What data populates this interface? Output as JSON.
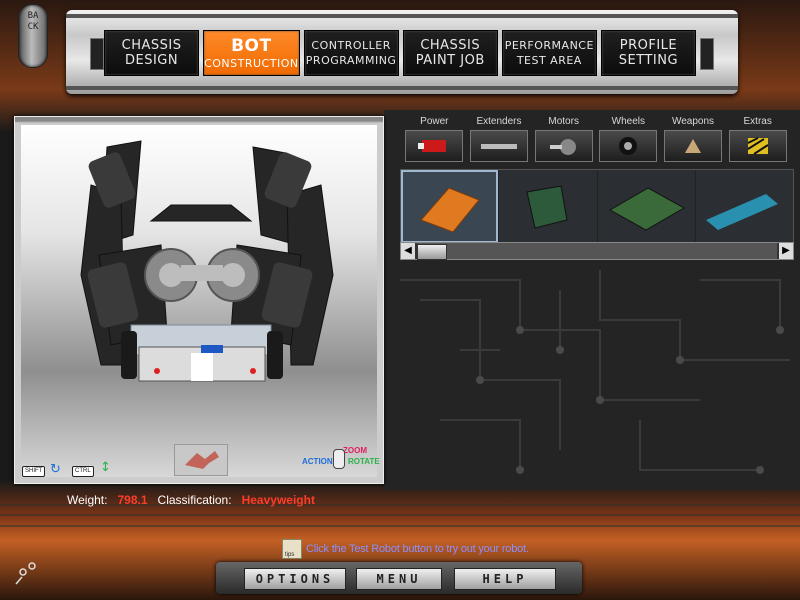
{
  "nav": {
    "back_label": "BACK",
    "tabs": [
      {
        "line1": "CHASSIS",
        "line2": "DESIGN"
      },
      {
        "line1": "BOT",
        "line2": "CONSTRUCTION"
      },
      {
        "line1": "CONTROLLER",
        "line2": "PROGRAMMING"
      },
      {
        "line1": "CHASSIS",
        "line2": "PAINT JOB"
      },
      {
        "line1": "PERFORMANCE",
        "line2": "TEST AREA"
      },
      {
        "line1": "PROFILE",
        "line2": "SETTING"
      }
    ],
    "active_tab": "BOT CONSTRUCTION"
  },
  "viewport": {
    "shift_key": "SHIFT",
    "ctrl_key": "CTRL",
    "zoom_label": "ZOOM",
    "action_label": "ACTION",
    "rotate_label": "ROTATE"
  },
  "parts": {
    "categories": [
      {
        "label": "Power",
        "icon": "battery-icon"
      },
      {
        "label": "Extenders",
        "icon": "extender-bar-icon"
      },
      {
        "label": "Motors",
        "icon": "motor-icon"
      },
      {
        "label": "Wheels",
        "icon": "wheel-icon"
      },
      {
        "label": "Weapons",
        "icon": "weapon-icon"
      },
      {
        "label": "Extras",
        "icon": "hazard-plate-icon"
      }
    ],
    "items": [
      {
        "icon": "orange-battery-icon",
        "selected": true
      },
      {
        "icon": "circuit-board-icon",
        "selected": false
      },
      {
        "icon": "controller-board-icon",
        "selected": false
      },
      {
        "icon": "blue-cylinder-icon",
        "selected": false
      }
    ]
  },
  "stats": {
    "weight_label": "Weight:",
    "weight_value": "798.1",
    "class_label": "Classification:",
    "class_value": "Heavyweight"
  },
  "tip": {
    "icon_label": "tips",
    "text": "Click the Test Robot button to try out your robot."
  },
  "bottom": {
    "options": "OPTIONS",
    "menu": "MENU",
    "help": "HELP"
  },
  "colors": {
    "active_tab": "#f06a00",
    "stat_value": "#ff3b2a",
    "tip_text": "#8a8fff",
    "zoom": "#e01f62",
    "action": "#1d6ed8",
    "rotate": "#2bb24a"
  }
}
